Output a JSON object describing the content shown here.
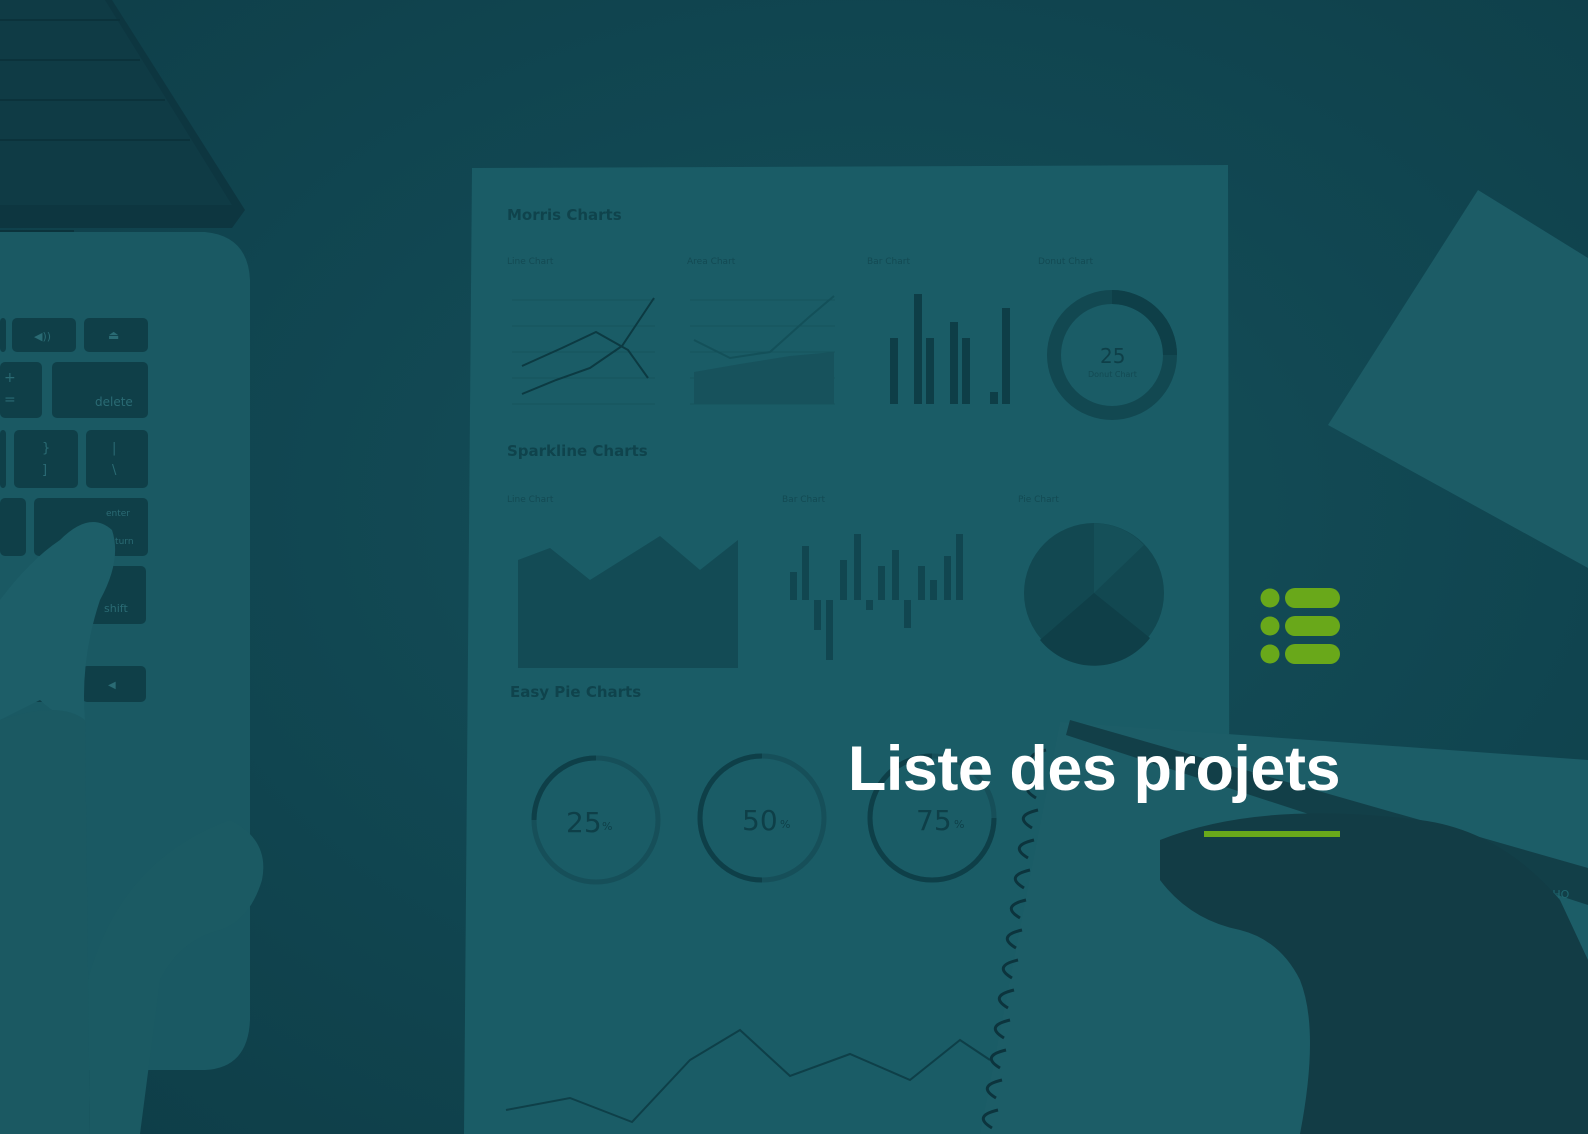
{
  "cover": {
    "title": "Liste des projets",
    "icon": "list-icon",
    "accent_color": "#69a81a",
    "background_color": "#114752",
    "title_color": "#ffffff"
  },
  "background_photo": {
    "paper": {
      "heading_morris": "Morris Charts",
      "heading_sparkline": "Sparkline Charts",
      "heading_easy_pie": "Easy Pie Charts",
      "label_line_chart": "Line Chart",
      "label_area_chart": "Area Chart",
      "label_bar_chart": "Bar Chart",
      "label_donut_chart": "Donut Chart",
      "label_pie_chart": "Pie Chart",
      "donut_value": "25",
      "donut_sub": "Donut Chart",
      "pie_25": "25",
      "pie_50": "50",
      "pie_75": "75",
      "percent": "%"
    },
    "laptop": {
      "key_delete": "delete",
      "key_enter": "enter",
      "key_return": "return",
      "key_shift": "shift"
    },
    "pen_brand": "eOSHO"
  }
}
